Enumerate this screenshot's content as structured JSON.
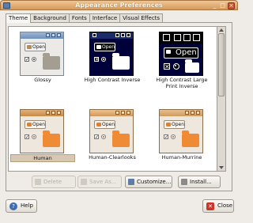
{
  "window": {
    "title": "Appearance Preferences",
    "min_glyph": "_",
    "max_glyph": "□",
    "close_glyph": "×"
  },
  "tabs": [
    {
      "label": "Theme",
      "active": true
    },
    {
      "label": "Background",
      "active": false
    },
    {
      "label": "Fonts",
      "active": false
    },
    {
      "label": "Interface",
      "active": false
    },
    {
      "label": "Visual Effects",
      "active": false
    }
  ],
  "themes": [
    {
      "name": "Glossy",
      "open_label": "Open",
      "selected": false
    },
    {
      "name": "High Contrast Inverse",
      "open_label": "Open",
      "selected": false
    },
    {
      "name": "High Contrast Large Print Inverse",
      "open_label": "Open",
      "selected": false
    },
    {
      "name": "Human",
      "open_label": "Open",
      "selected": true
    },
    {
      "name": "Human-Clearlooks",
      "open_label": "Open",
      "selected": false
    },
    {
      "name": "Human-Murrine",
      "open_label": "Open",
      "selected": false
    }
  ],
  "actions": {
    "delete": "Delete",
    "save_as": "Save As...",
    "customize": "Customize...",
    "install": "Install..."
  },
  "footer": {
    "help": "Help",
    "close": "Close"
  },
  "colors": {
    "accent": "#d59a5a",
    "selection": "#d6c8b2"
  }
}
